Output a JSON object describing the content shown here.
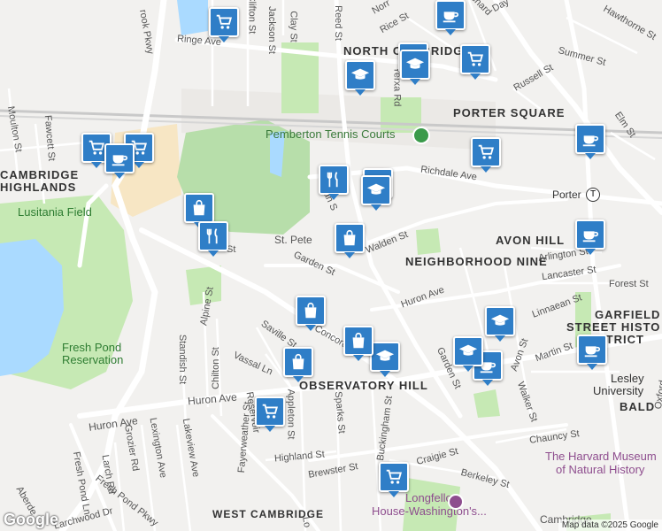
{
  "labels": {
    "neighborhoods": [
      {
        "id": "north-cambridge",
        "text": "NORTH CAMBRIDGE"
      },
      {
        "id": "porter-square",
        "text": "PORTER SQUARE"
      },
      {
        "id": "cambridge-highlands-1",
        "text": "CAMBRIDGE"
      },
      {
        "id": "cambridge-highlands-2",
        "text": "HIGHLANDS"
      },
      {
        "id": "avon-hill",
        "text": "AVON HILL"
      },
      {
        "id": "neighborhood-nine",
        "text": "NEIGHBORHOOD NINE"
      },
      {
        "id": "garfield-1",
        "text": "GARFIELD"
      },
      {
        "id": "garfield-2",
        "text": "STREET HISTO"
      },
      {
        "id": "garfield-3",
        "text": "DISTRICT"
      },
      {
        "id": "observatory-hill",
        "text": "OBSERVATORY HILL"
      },
      {
        "id": "west-cambridge",
        "text": "WEST CAMBRIDGE"
      },
      {
        "id": "baldwin",
        "text": "BALD"
      }
    ],
    "parks": [
      {
        "id": "lusitania",
        "text": "Lusitania Field"
      },
      {
        "id": "fresh-pond-1",
        "text": "Fresh Pond"
      },
      {
        "id": "fresh-pond-2",
        "text": "Reservation"
      }
    ],
    "pois": [
      {
        "id": "pemberton",
        "text": "Pemberton Tennis Courts"
      },
      {
        "id": "porter-station",
        "text": "Porter"
      },
      {
        "id": "lesley-1",
        "text": "Lesley"
      },
      {
        "id": "lesley-2",
        "text": "University"
      },
      {
        "id": "museum-1",
        "text": "The Harvard Museum"
      },
      {
        "id": "museum-2",
        "text": "of Natural History"
      },
      {
        "id": "longfellow-1",
        "text": "Longfellow"
      },
      {
        "id": "longfellow-2",
        "text": "House-Washington's..."
      },
      {
        "id": "st-pete",
        "text": "St. Pete"
      },
      {
        "id": "cambridge-bottom",
        "text": "Cambridge"
      }
    ],
    "streets": [
      {
        "id": "ringe",
        "text": "Ringe Ave"
      },
      {
        "id": "brook-pkwy",
        "text": "rook Pkwy"
      },
      {
        "id": "clifton",
        "text": "Clifton St"
      },
      {
        "id": "jackson",
        "text": "Jackson St"
      },
      {
        "id": "clay",
        "text": "Clay St"
      },
      {
        "id": "reed",
        "text": "Reed St"
      },
      {
        "id": "rice",
        "text": "Rice St"
      },
      {
        "id": "yerxa",
        "text": "Yerxa Rd"
      },
      {
        "id": "russell",
        "text": "Russell St"
      },
      {
        "id": "summer",
        "text": "Summer St"
      },
      {
        "id": "hawthorne",
        "text": "Hawthorne St"
      },
      {
        "id": "elm",
        "text": "Elm St"
      },
      {
        "id": "richdale",
        "text": "Richdale Ave"
      },
      {
        "id": "moulton",
        "text": "Moulton St"
      },
      {
        "id": "fawcett",
        "text": "Fawcett St"
      },
      {
        "id": "walden",
        "text": "Walden St"
      },
      {
        "id": "garden-1",
        "text": "Garden St"
      },
      {
        "id": "garden-2",
        "text": "Garden St"
      },
      {
        "id": "arlington",
        "text": "Arlington St"
      },
      {
        "id": "lancaster",
        "text": "Lancaster St"
      },
      {
        "id": "forest",
        "text": "Forest St"
      },
      {
        "id": "linnaean",
        "text": "Linnaean St"
      },
      {
        "id": "huron-1",
        "text": "Huron Ave"
      },
      {
        "id": "huron-2",
        "text": "Huron Ave"
      },
      {
        "id": "huron-3",
        "text": "Huron Ave"
      },
      {
        "id": "alpine",
        "text": "Alpine St"
      },
      {
        "id": "standish",
        "text": "Standish St"
      },
      {
        "id": "chilton",
        "text": "Chilton St"
      },
      {
        "id": "saville",
        "text": "Saville St"
      },
      {
        "id": "vassal",
        "text": "Vassal Ln"
      },
      {
        "id": "concord",
        "text": "Concord Ave"
      },
      {
        "id": "avon",
        "text": "Avon St"
      },
      {
        "id": "martin",
        "text": "Martin St"
      },
      {
        "id": "walker",
        "text": "Walker St"
      },
      {
        "id": "chauncy",
        "text": "Chauncy St"
      },
      {
        "id": "appleton",
        "text": "Appleton St"
      },
      {
        "id": "sparks",
        "text": "Sparks St"
      },
      {
        "id": "buckingham",
        "text": "Buckingham St"
      },
      {
        "id": "fayerweather",
        "text": "Fayerweather St"
      },
      {
        "id": "lakeview",
        "text": "Lakeview Ave"
      },
      {
        "id": "lexington",
        "text": "Lexington Ave"
      },
      {
        "id": "grozier",
        "text": "Grozier Rd"
      },
      {
        "id": "larch",
        "text": "Larch Rd"
      },
      {
        "id": "fresh-pond-ln",
        "text": "Fresh Pond Ln"
      },
      {
        "id": "fresh-pond-pkwy",
        "text": "Fresh Pond Pkwy"
      },
      {
        "id": "larchwood",
        "text": "Larchwood Dr"
      },
      {
        "id": "highland",
        "text": "Highland St"
      },
      {
        "id": "brewster",
        "text": "Brewster St"
      },
      {
        "id": "craigie",
        "text": "Craigie St"
      },
      {
        "id": "berkeley",
        "text": "Berkeley St"
      },
      {
        "id": "reservoir",
        "text": "Reservoir"
      },
      {
        "id": "aberdeen",
        "text": "Aberde"
      },
      {
        "id": "oxford",
        "text": "Oxford"
      },
      {
        "id": "garden-st-top",
        "text": "St"
      },
      {
        "id": "ian-s",
        "text": "ian S"
      },
      {
        "id": "lo",
        "text": "Lo"
      },
      {
        "id": "norr",
        "text": "Norr"
      },
      {
        "id": "chard",
        "text": "chard"
      },
      {
        "id": "day",
        "text": "Day"
      }
    ]
  },
  "markers": [
    {
      "type": "shopping-cart",
      "color": "#2f7ec7"
    },
    {
      "type": "shopping-cart",
      "color": "#2f7ec7"
    },
    {
      "type": "shopping-cart",
      "color": "#2f7ec7"
    },
    {
      "type": "shopping-cart",
      "color": "#2f7ec7"
    },
    {
      "type": "shopping-cart",
      "color": "#2f7ec7"
    },
    {
      "type": "shopping-cart",
      "color": "#2f7ec7"
    },
    {
      "type": "shopping-cart",
      "color": "#2f7ec7"
    },
    {
      "type": "coffee-cup",
      "color": "#2f7ec7"
    },
    {
      "type": "coffee-cup",
      "color": "#2f7ec7"
    },
    {
      "type": "coffee-cup",
      "color": "#2f7ec7"
    },
    {
      "type": "coffee-cup",
      "color": "#2f7ec7"
    },
    {
      "type": "coffee-cup",
      "color": "#2f7ec7"
    },
    {
      "type": "coffee-cup",
      "color": "#2f7ec7"
    },
    {
      "type": "graduation-cap",
      "color": "#2f7ec7"
    },
    {
      "type": "graduation-cap",
      "color": "#2f7ec7"
    },
    {
      "type": "graduation-cap",
      "color": "#2f7ec7"
    },
    {
      "type": "graduation-cap",
      "color": "#2f7ec7"
    },
    {
      "type": "graduation-cap",
      "color": "#2f7ec7"
    },
    {
      "type": "graduation-cap",
      "color": "#2f7ec7"
    },
    {
      "type": "graduation-cap",
      "color": "#2f7ec7"
    },
    {
      "type": "graduation-cap",
      "color": "#2f7ec7"
    },
    {
      "type": "shopping-bag",
      "color": "#2f7ec7"
    },
    {
      "type": "shopping-bag",
      "color": "#2f7ec7"
    },
    {
      "type": "shopping-bag",
      "color": "#2f7ec7"
    },
    {
      "type": "shopping-bag",
      "color": "#2f7ec7"
    },
    {
      "type": "shopping-bag",
      "color": "#2f7ec7"
    },
    {
      "type": "fork-knife",
      "color": "#2f7ec7"
    },
    {
      "type": "fork-knife",
      "color": "#2f7ec7"
    }
  ],
  "colors": {
    "water": "#aadaff",
    "park": "#c6e9b4",
    "road": "#ffffff",
    "sand": "#f7e6c4",
    "marker": "#2f7ec7"
  },
  "attribution": {
    "logo": "Google",
    "copyright": "Map data ©2025 Google"
  }
}
